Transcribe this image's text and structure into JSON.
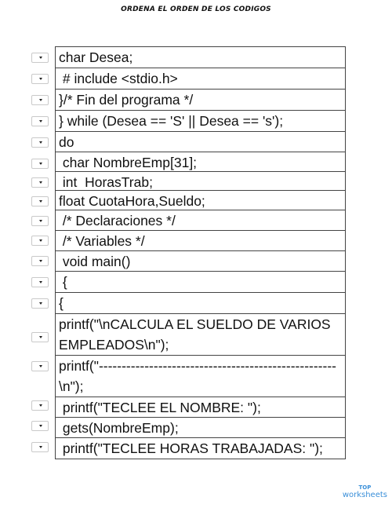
{
  "worksheet": {
    "title": "ORDENA EL ORDEN DE LOS CODIGOS",
    "rows": [
      {
        "text": "char Desea;"
      },
      {
        "text": " # include <stdio.h>"
      },
      {
        "text": "}/* Fin del programa */"
      },
      {
        "text": "} while (Desea == 'S' || Desea == 's');"
      },
      {
        "text": "do"
      },
      {
        "text": " char NombreEmp[31];"
      },
      {
        "text": " int  HorasTrab;"
      },
      {
        "text": "float CuotaHora,Sueldo;"
      },
      {
        "text": " /* Declaraciones */"
      },
      {
        "text": " /* Variables */"
      },
      {
        "text": " void main()"
      },
      {
        "text": " {"
      },
      {
        "text": "{"
      },
      {
        "text": "printf(\"\\nCALCULA EL SUELDO DE VARIOS EMPLEADOS\\n\");"
      },
      {
        "text": " printf(\"----------------------------------------------------\\n\");"
      },
      {
        "text": " printf(\"TECLEE EL NOMBRE: \");"
      },
      {
        "text": " gets(NombreEmp);"
      },
      {
        "text": " printf(\"TECLEE HORAS TRABAJADAS: \");"
      }
    ]
  },
  "branding": {
    "logo_top": "TOP",
    "logo_main": "worksheets",
    "color": "#3a8fd9"
  }
}
